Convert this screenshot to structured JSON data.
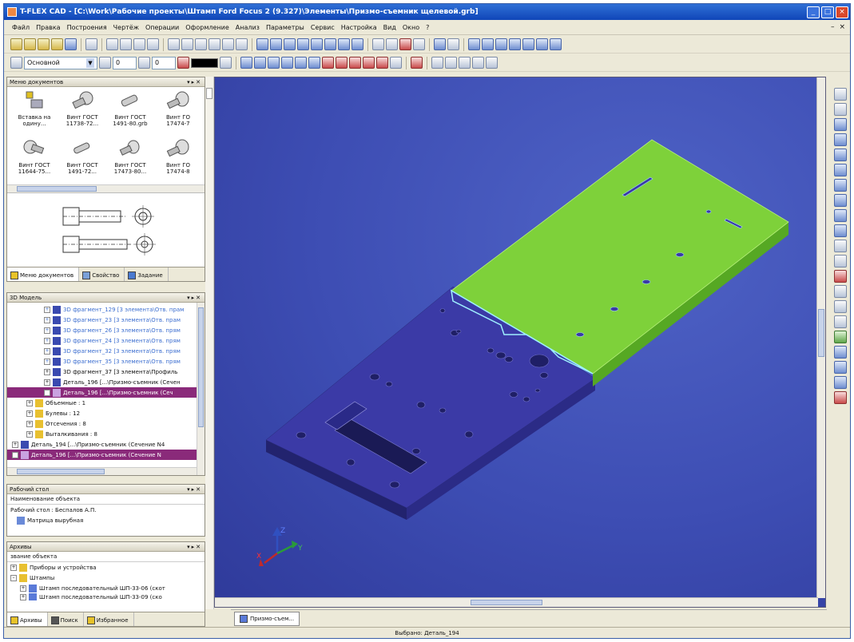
{
  "window": {
    "title": "T-FLEX CAD - [C:\\Work\\Рабочие проекты\\Штамп Ford Focus 2 (9.327)\\Элементы\\Призмо-съемник щелевой.grb]",
    "min": "_",
    "max": "□",
    "close": "×"
  },
  "menu": {
    "items": [
      "Файл",
      "Правка",
      "Построения",
      "Чертёж",
      "Операции",
      "Оформление",
      "Анализ",
      "Параметры",
      "Сервис",
      "Настройка",
      "Вид",
      "Окно",
      "?"
    ],
    "mdi_min": "–",
    "mdi_close": "×"
  },
  "toolbar3": {
    "layer": "Основной",
    "level": "0",
    "priority": "0"
  },
  "library": {
    "header": "Меню документов",
    "items": [
      {
        "label1": "Вставка на",
        "label2": "одину..."
      },
      {
        "label1": "Винт ГОСТ",
        "label2": "11738-72..."
      },
      {
        "label1": "Винт ГОСТ",
        "label2": "1491-80.grb"
      },
      {
        "label1": "Винт ГО",
        "label2": "17474-7"
      },
      {
        "label1": "Винт ГОСТ",
        "label2": "11644-75..."
      },
      {
        "label1": "Винт ГОСТ",
        "label2": "1491-72..."
      },
      {
        "label1": "Винт ГОСТ",
        "label2": "17473-80..."
      },
      {
        "label1": "Винт ГО",
        "label2": "17474-8"
      }
    ],
    "tabs": [
      "Меню документов",
      "Свойство",
      "Задание"
    ]
  },
  "model": {
    "header": "3D Модель",
    "rows": [
      {
        "text": "3D фрагмент_129 [3 элемента\\Отв. прам",
        "style": "blue",
        "indent": 46
      },
      {
        "text": "3D фрагмент_23 [3 элемента\\Отв. прам",
        "style": "blue",
        "indent": 46
      },
      {
        "text": "3D фрагмент_26 [3 элемента\\Отв. прям",
        "style": "blue",
        "indent": 46
      },
      {
        "text": "3D фрагмент_24 [3 элемента\\Отв. прям",
        "style": "blue",
        "indent": 46
      },
      {
        "text": "3D фрагмент_32 [3 элемента\\Отв. прям",
        "style": "blue",
        "indent": 46
      },
      {
        "text": "3D фрагмент_35 [3 элемента\\Отв. прям",
        "style": "blue",
        "indent": 46
      },
      {
        "text": "3D фрагмент_37 [3 элемента\\Профиль",
        "style": "",
        "indent": 46
      },
      {
        "text": "Деталь_196 [...\\Призмо-съемник (Сечен",
        "style": "",
        "indent": 46
      },
      {
        "text": "Деталь_196 [...\\Призмо-съемник (Сеч",
        "style": "sel",
        "indent": 46
      },
      {
        "text": "Объемные : 1",
        "style": "",
        "indent": 24
      },
      {
        "text": "Булевы : 12",
        "style": "",
        "indent": 24
      },
      {
        "text": "Отсечения : 8",
        "style": "",
        "indent": 24
      },
      {
        "text": "Выталкивания : 8",
        "style": "",
        "indent": 24
      },
      {
        "text": "Деталь_194 [...\\Призмо-съемник (Сечение N4",
        "style": "",
        "indent": 6
      },
      {
        "text": "Деталь_196 [...\\Призмо-съемник (Сечение N",
        "style": "sel",
        "indent": 6
      }
    ]
  },
  "workplace": {
    "header": "Рабочий стол",
    "col": "Наименование объекта",
    "line1": "Рабочий стол : Беспалов А.П.",
    "line2": "Матрица вырубная"
  },
  "archives": {
    "header": "Архивы",
    "col": "звание объекта",
    "rows": [
      {
        "text": "Приборы и устройства",
        "indent": 12
      },
      {
        "text": "Штампы",
        "indent": 12
      },
      {
        "text": "Штамп последовательный ШП-33-06 (скот",
        "indent": 24
      },
      {
        "text": "Штамп последовательный ШП-33-09 (ско",
        "indent": 24
      }
    ],
    "tabs": [
      "Архивы",
      "Поиск",
      "Избранное"
    ]
  },
  "viewport": {
    "tab": "Призмо-съем...",
    "axis_x": "X",
    "axis_y": "Y",
    "axis_z": "Z",
    "colors": {
      "green": "#7ed13a",
      "blue": "#3b3aa6"
    }
  },
  "status": {
    "text": "Выбрано: Деталь_194"
  }
}
